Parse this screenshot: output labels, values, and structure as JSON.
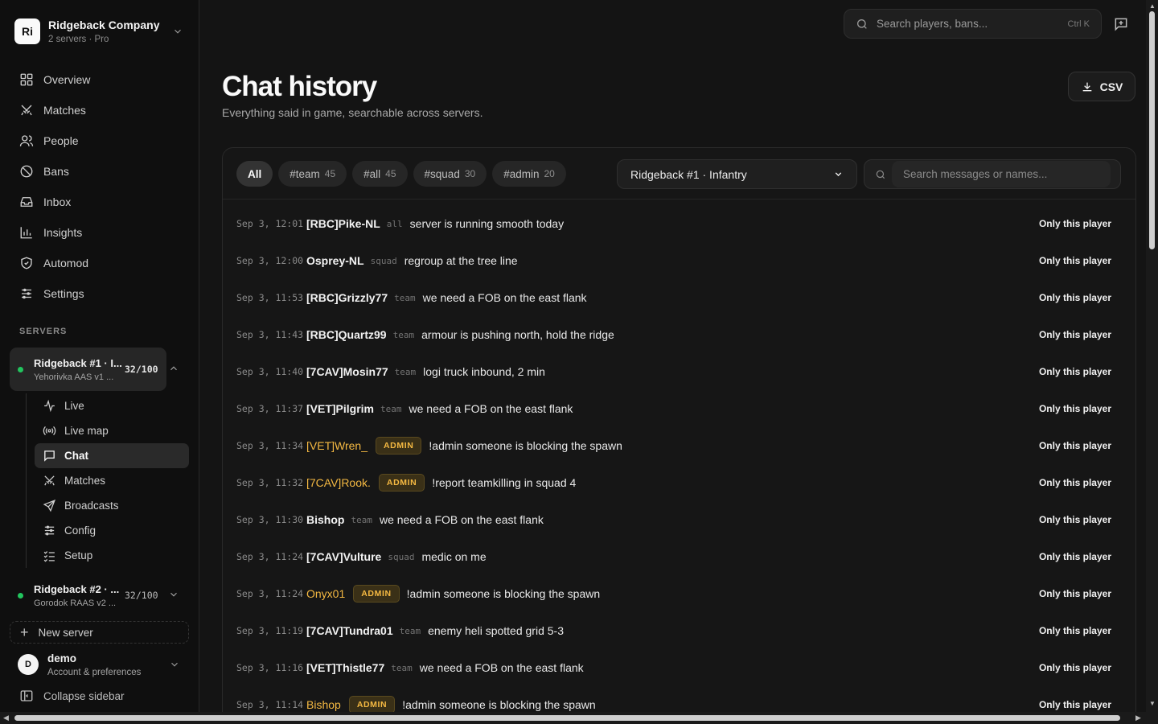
{
  "org": {
    "logo": "Ri",
    "name": "Ridgeback Company",
    "sub": "2 servers · Pro"
  },
  "nav": [
    {
      "label": "Overview",
      "icon": "grid-icon"
    },
    {
      "label": "Matches",
      "icon": "swords-icon"
    },
    {
      "label": "People",
      "icon": "users-icon"
    },
    {
      "label": "Bans",
      "icon": "ban-icon"
    },
    {
      "label": "Inbox",
      "icon": "inbox-icon"
    },
    {
      "label": "Insights",
      "icon": "chart-icon"
    },
    {
      "label": "Automod",
      "icon": "shield-icon"
    },
    {
      "label": "Settings",
      "icon": "sliders-icon"
    }
  ],
  "servers_label": "SERVERS",
  "servers": [
    {
      "name": "Ridgeback #1 · I...",
      "map": "Yehorivka AAS v1 ...",
      "count": "32/100"
    },
    {
      "name": "Ridgeback #2 · ...",
      "map": "Gorodok RAAS v2 ...",
      "count": "32/100"
    }
  ],
  "subnav": [
    "Live",
    "Live map",
    "Chat",
    "Matches",
    "Broadcasts",
    "Config",
    "Setup"
  ],
  "new_server": "New server",
  "user": {
    "initial": "D",
    "name": "demo",
    "sub": "Account & preferences"
  },
  "collapse": "Collapse sidebar",
  "search": {
    "placeholder": "Search players, bans...",
    "shortcut": "Ctrl K"
  },
  "page": {
    "title": "Chat history",
    "subtitle": "Everything said in game, searchable across servers.",
    "csv": "CSV"
  },
  "chips": [
    {
      "label": "All",
      "count": ""
    },
    {
      "label": "#team",
      "count": "45"
    },
    {
      "label": "#all",
      "count": "45"
    },
    {
      "label": "#squad",
      "count": "30"
    },
    {
      "label": "#admin",
      "count": "20"
    }
  ],
  "server_select": "Ridgeback #1 · Infantry",
  "msg_search_placeholder": "Search messages or names...",
  "only_label": "Only this player",
  "messages": [
    {
      "ts": "Sep 3, 12:01",
      "name": "[RBC]Pike-NL",
      "chan": "all",
      "admin": false,
      "text": "server is running smooth today"
    },
    {
      "ts": "Sep 3, 12:00",
      "name": "Osprey-NL",
      "chan": "squad",
      "admin": false,
      "text": "regroup at the tree line"
    },
    {
      "ts": "Sep 3, 11:53",
      "name": "[RBC]Grizzly77",
      "chan": "team",
      "admin": false,
      "text": "we need a FOB on the east flank"
    },
    {
      "ts": "Sep 3, 11:43",
      "name": "[RBC]Quartz99",
      "chan": "team",
      "admin": false,
      "text": "armour is pushing north, hold the ridge"
    },
    {
      "ts": "Sep 3, 11:40",
      "name": "[7CAV]Mosin77",
      "chan": "team",
      "admin": false,
      "text": "logi truck inbound, 2 min"
    },
    {
      "ts": "Sep 3, 11:37",
      "name": "[VET]Pilgrim",
      "chan": "team",
      "admin": false,
      "text": "we need a FOB on the east flank"
    },
    {
      "ts": "Sep 3, 11:34",
      "name": "[VET]Wren_",
      "chan": "ADMIN",
      "admin": true,
      "text": "!admin someone is blocking the spawn"
    },
    {
      "ts": "Sep 3, 11:32",
      "name": "[7CAV]Rook.",
      "chan": "ADMIN",
      "admin": true,
      "text": "!report teamkilling in squad 4"
    },
    {
      "ts": "Sep 3, 11:30",
      "name": "Bishop",
      "chan": "team",
      "admin": false,
      "text": "we need a FOB on the east flank"
    },
    {
      "ts": "Sep 3, 11:24",
      "name": "[7CAV]Vulture",
      "chan": "squad",
      "admin": false,
      "text": "medic on me"
    },
    {
      "ts": "Sep 3, 11:24",
      "name": "Onyx01",
      "chan": "ADMIN",
      "admin": true,
      "text": "!admin someone is blocking the spawn"
    },
    {
      "ts": "Sep 3, 11:19",
      "name": "[7CAV]Tundra01",
      "chan": "team",
      "admin": false,
      "text": "enemy heli spotted grid 5-3"
    },
    {
      "ts": "Sep 3, 11:16",
      "name": "[VET]Thistle77",
      "chan": "team",
      "admin": false,
      "text": "we need a FOB on the east flank"
    },
    {
      "ts": "Sep 3, 11:14",
      "name": "Bishop",
      "chan": "ADMIN",
      "admin": true,
      "text": "!admin someone is blocking the spawn"
    }
  ]
}
